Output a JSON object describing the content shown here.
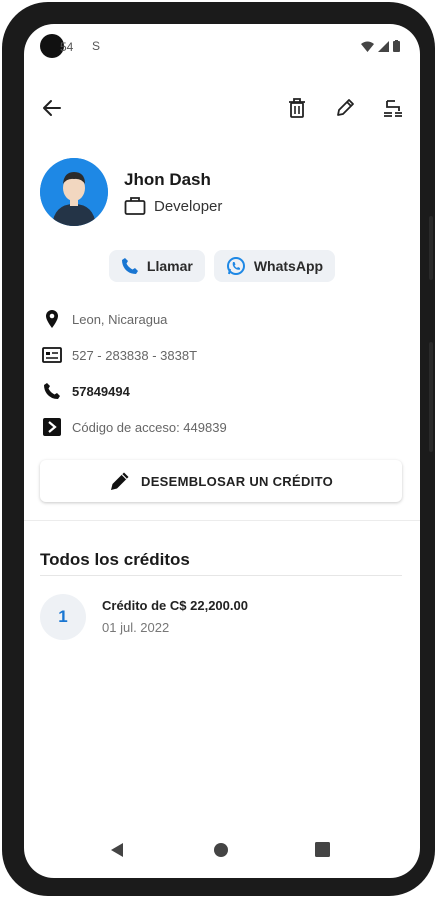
{
  "status_bar": {
    "time": "54",
    "extra_glyph": "S"
  },
  "header": {
    "back_icon": "arrow-back-icon",
    "actions": [
      "delete-icon",
      "edit-icon",
      "list-settings-icon"
    ]
  },
  "profile": {
    "name": "Jhon Dash",
    "role": "Developer",
    "avatar_color": "#1e88e5"
  },
  "actions": [
    {
      "label": "Llamar",
      "icon": "phone-icon"
    },
    {
      "label": "WhatsApp",
      "icon": "whatsapp-icon"
    }
  ],
  "details": {
    "location": "Leon, Nicaragua",
    "id_number": "527 - 283838 - 3838T",
    "phone": "57849494",
    "access_code": "Código de acceso: 449839"
  },
  "primary_button": {
    "label": "DESEMBLOSAR UN CRÉDITO"
  },
  "credits": {
    "title": "Todos los créditos",
    "items": [
      {
        "index": "1",
        "title": "Crédito de C$ 22,200.00",
        "date": "01 jul. 2022"
      }
    ]
  },
  "colors": {
    "accent": "#1976d2",
    "whatsapp_blue": "#1e88e5",
    "pill_bg": "#eef1f5"
  }
}
